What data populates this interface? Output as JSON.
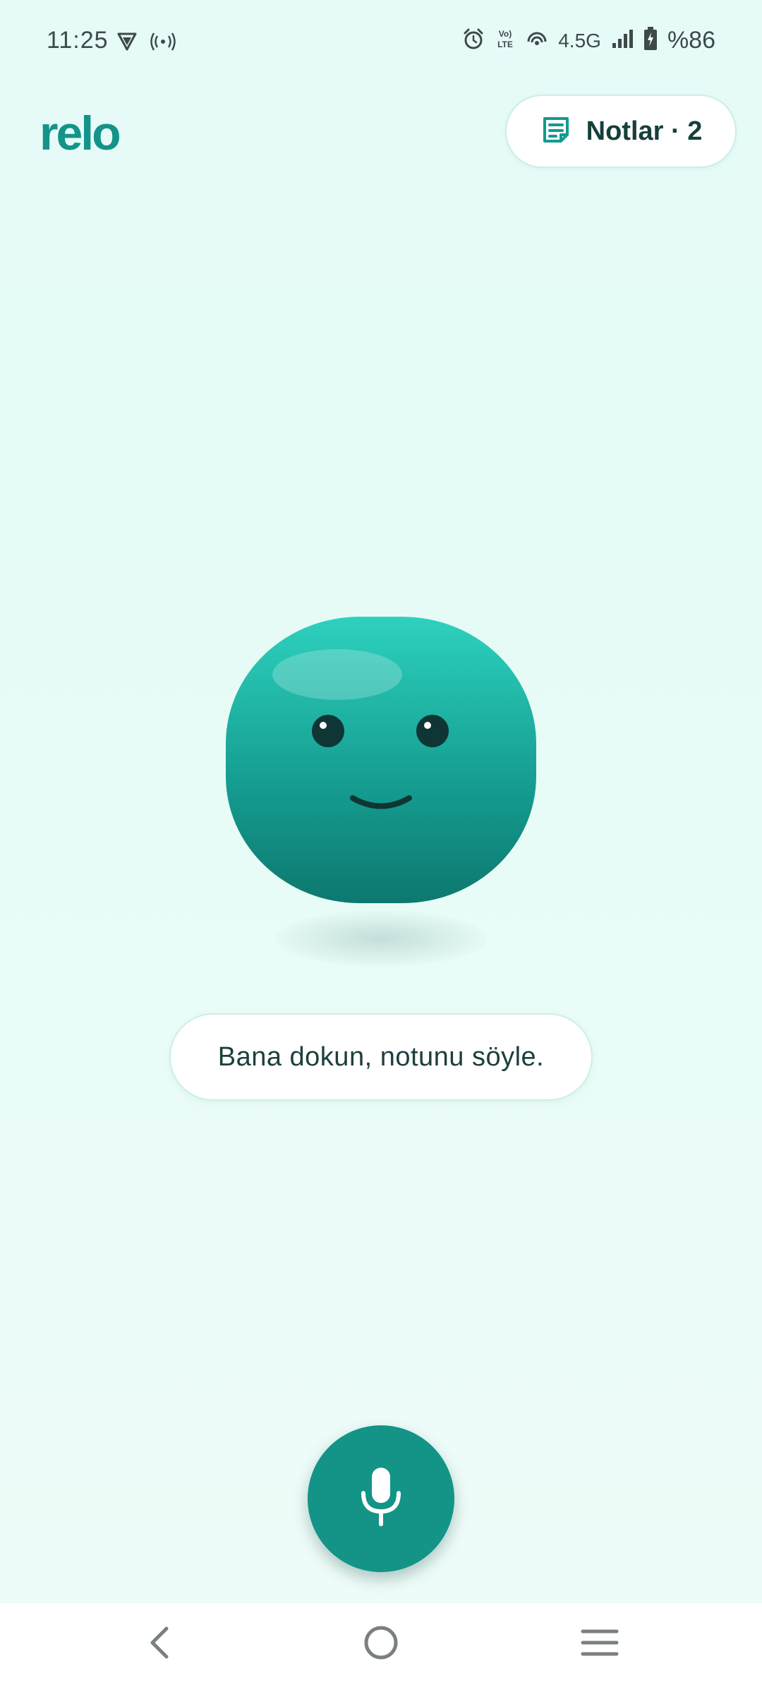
{
  "status_bar": {
    "time": "11:25",
    "network_type": "4.5G",
    "battery_text": "%86",
    "icons": [
      "vpn-icon",
      "hotspot-icon",
      "alarm-icon",
      "volte-icon",
      "wifi-calling-icon",
      "signal-icon",
      "battery-charging-icon"
    ]
  },
  "header": {
    "brand": "relo",
    "notes_button_label": "Notlar · 2",
    "notes_icon": "note-icon"
  },
  "mascot": {
    "name": "smiling-blob-mascot"
  },
  "hint": {
    "text": "Bana dokun, notunu söyle."
  },
  "mic_button": {
    "icon": "microphone-icon"
  },
  "nav": {
    "items": [
      "back-icon",
      "home-icon",
      "menu-icon"
    ]
  },
  "colors": {
    "accent": "#139487",
    "brand": "#14938a",
    "background": "#e6fbf8",
    "text_dark": "#163f3c"
  }
}
